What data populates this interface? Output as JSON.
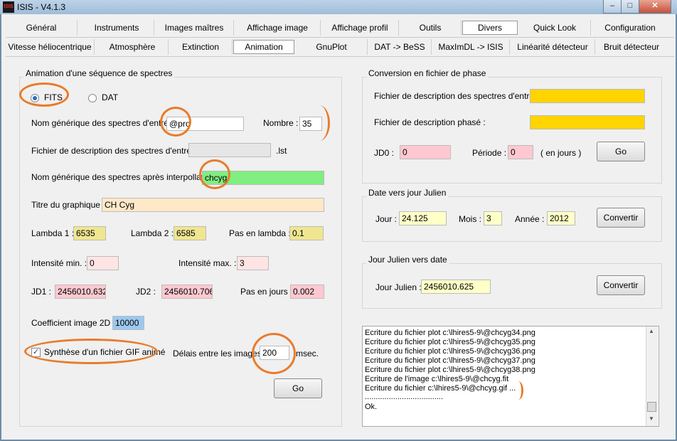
{
  "window": {
    "title": "ISIS - V4.1.3",
    "icon_text": "ISIS"
  },
  "tabs_row1": [
    "Général",
    "Instruments",
    "Images maîtres",
    "Affichage image",
    "Affichage profil",
    "Outils",
    "Divers",
    "Quick Look",
    "Configuration"
  ],
  "tabs_row2": [
    "Vitesse héliocentrique",
    "Atmosphère",
    "Extinction",
    "Animation",
    "GnuPlot",
    "DAT -> BeSS",
    "MaxImDL -> ISIS",
    "Linéarité détecteur",
    "Bruit détecteur"
  ],
  "active_tab_row1": "Divers",
  "active_tab_row2": "Animation",
  "anim": {
    "title": "Animation d'une séquence de spectres",
    "fits_label": "FITS",
    "dat_label": "DAT",
    "generic_label": "Nom générique des spectres d'entrée :",
    "generic_value": "@pro",
    "nombre_label": "Nombre :",
    "nombre_value": "35",
    "desc_label": "Fichier de description des spectres d'entrée :",
    "desc_value": "",
    "desc_ext": ".lst",
    "interp_label": "Nom générique des spectres après interpollation :",
    "interp_value": "chcyg",
    "titre_label": "Titre du graphique :",
    "titre_value": "CH Cyg",
    "lambda1_label": "Lambda 1 :",
    "lambda1_value": "6535",
    "lambda2_label": "Lambda 2 :",
    "lambda2_value": "6585",
    "pas_lambda_label": "Pas en lambda :",
    "pas_lambda_value": "0.1",
    "imin_label": "Intensité min. :",
    "imin_value": "0",
    "imax_label": "Intensité max. :",
    "imax_value": "3",
    "jd1_label": "JD1 :",
    "jd1_value": "2456010.632",
    "jd2_label": "JD2 :",
    "jd2_value": "2456010.706",
    "pas_jours_label": "Pas en jours :",
    "pas_jours_value": "0.002",
    "coef_label": "Coefficient image 2D :",
    "coef_value": "10000",
    "gif_label": "Synthèse d'un fichier GIF animé",
    "delai_label": "Délais entre les images :",
    "delai_value": "200",
    "delai_unit": "msec.",
    "go_label": "Go"
  },
  "phase": {
    "title": "Conversion en fichier de phase",
    "desc_in_label": "Fichier de description des spectres d'entrée :",
    "desc_in_value": "",
    "desc_phase_label": "Fichier de description phasé :",
    "desc_phase_value": "",
    "jd0_label": "JD0 :",
    "jd0_value": "0",
    "periode_label": "Période :",
    "periode_value": "0",
    "unit_label": "( en jours )",
    "go_label": "Go"
  },
  "date_julian": {
    "title": "Date vers jour Julien",
    "jour_label": "Jour :",
    "jour_value": "24.125",
    "mois_label": "Mois :",
    "mois_value": "3",
    "annee_label": "Année :",
    "annee_value": "2012",
    "button_label": "Convertir"
  },
  "julian_date": {
    "title": "Jour Julien vers date",
    "jour_label": "Jour Julien :",
    "jour_value": "2456010.625",
    "button_label": "Convertir"
  },
  "log": [
    "Ecriture du fichier plot c:\\lhires5-9\\@chcyg34.png",
    "Ecriture du fichier plot c:\\lhires5-9\\@chcyg35.png",
    "Ecriture du fichier plot c:\\lhires5-9\\@chcyg36.png",
    "Ecriture du fichier plot c:\\lhires5-9\\@chcyg37.png",
    "Ecriture du fichier plot c:\\lhires5-9\\@chcyg38.png",
    "Ecriture de l'image c:\\lhires5-9\\@chcyg.fit",
    "Ecriture du fichier c:\\lhires5-9\\@chcyg.gif ...",
    "....................................",
    "Ok."
  ],
  "colors": {
    "yellow": "#ffd400",
    "pink": "#ffc8d0",
    "light_yellow": "#ffffc8",
    "khaki": "#f0e690",
    "light_pink": "#ffe4e4",
    "green": "#80ee80",
    "peach": "#ffe8c8",
    "blue": "#9cc8f0",
    "gray": "#f0f0f0",
    "annotation": "#e97b2a"
  }
}
